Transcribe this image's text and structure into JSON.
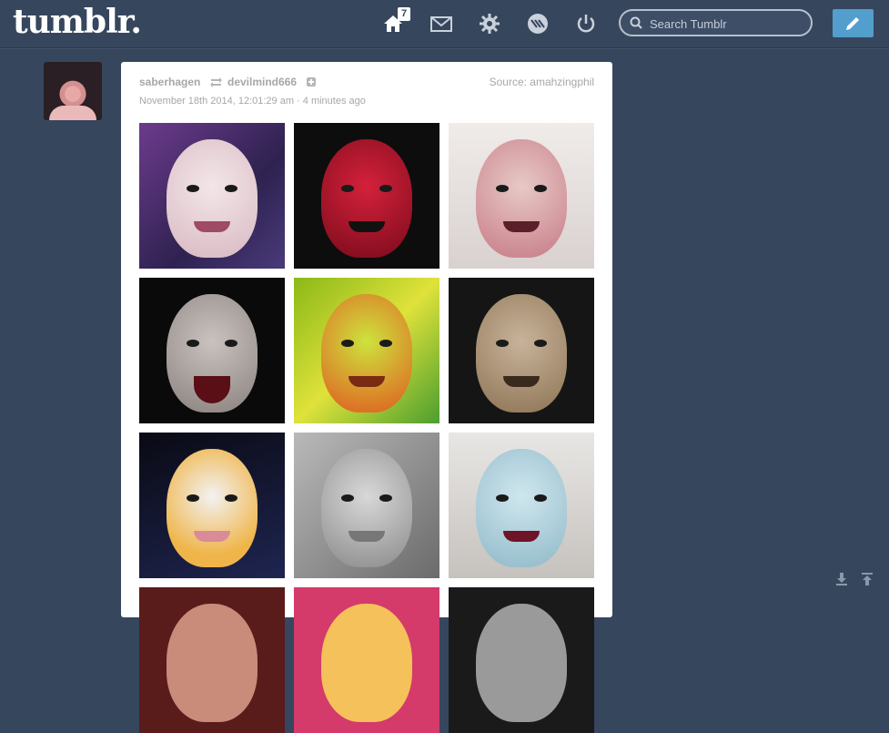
{
  "header": {
    "logo": "tumblr.",
    "home_badge": "7",
    "search_placeholder": "Search Tumblr",
    "icons": [
      "home-icon",
      "mail-icon",
      "gear-icon",
      "activity-icon",
      "power-icon",
      "pencil-icon"
    ]
  },
  "post": {
    "user": "saberhagen",
    "reblogged_from": "devilmind666",
    "source": "Source: amahzingphil",
    "timestamp": "November 18th 2014, 12:01:29 am · 4 minutes ago",
    "photo_count_visible": 12
  },
  "utility": {
    "icons": [
      "download-icon",
      "scroll-top-icon"
    ]
  },
  "colors": {
    "background": "#36465d",
    "accent": "#529ecc",
    "card": "#ffffff",
    "meta_text": "#a7a7a7"
  }
}
